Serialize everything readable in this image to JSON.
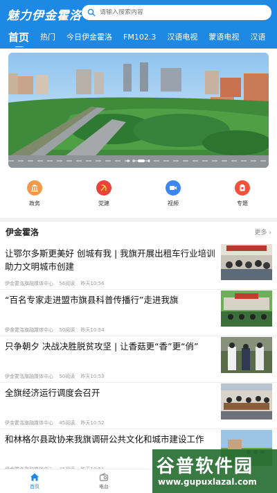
{
  "header": {
    "app_title": "魅力伊金霍洛",
    "search_placeholder": "请输入搜索内容",
    "accent_color": "#1e88e5"
  },
  "tabs": [
    {
      "label": "首页"
    },
    {
      "label": "热门"
    },
    {
      "label": "今日伊金霍洛"
    },
    {
      "label": "FM102.3"
    },
    {
      "label": "汉语电视"
    },
    {
      "label": "蒙语电视"
    },
    {
      "label": "汉语"
    }
  ],
  "quick_nav": [
    {
      "label": "政务",
      "icon": "government-icon",
      "color": "#f39a4a"
    },
    {
      "label": "党建",
      "icon": "party-building-icon",
      "color": "#e9433a"
    },
    {
      "label": "视频",
      "icon": "video-icon",
      "color": "#3d86f5"
    },
    {
      "label": "专题",
      "icon": "topic-icon",
      "color": "#f2513a"
    }
  ],
  "section": {
    "title": "伊金霍洛",
    "more_label": "更多"
  },
  "news": [
    {
      "title": "让鄂尔多斯更美好 创城有我 | 我旗开展出租车行业培训助力文明城市创建",
      "source": "伊金霍洛旗融媒体中心",
      "reads": "56阅读",
      "time": "昨天10:56"
    },
    {
      "title": "“百名专家走进盟市旗县科普传播行”走进我旗",
      "source": "伊金霍洛旗融媒体中心",
      "reads": "50阅读",
      "time": "昨天10:54"
    },
    {
      "title": "只争朝夕 决战决胜脱贫攻坚 | 让香菇更“香”更“俏”",
      "source": "伊金霍洛旗融媒体中心",
      "reads": "50阅读",
      "time": "昨天10:53"
    },
    {
      "title": "全旗经济运行调度会召开",
      "source": "伊金霍洛旗融媒体中心",
      "reads": "45阅读",
      "time": "昨天10:52"
    },
    {
      "title": "和林格尔县政协来我旗调研公共文化和城市建设工作",
      "source": "伊金霍洛旗融媒体中心",
      "reads": "45阅读",
      "time": "昨天10:51"
    }
  ],
  "bottom_nav": [
    {
      "label": "首页",
      "icon": "home-icon"
    },
    {
      "label": "电台",
      "icon": "radio-icon"
    }
  ],
  "watermark": {
    "text": "谷普软件园",
    "url": "www.gupuxlazal.com"
  }
}
